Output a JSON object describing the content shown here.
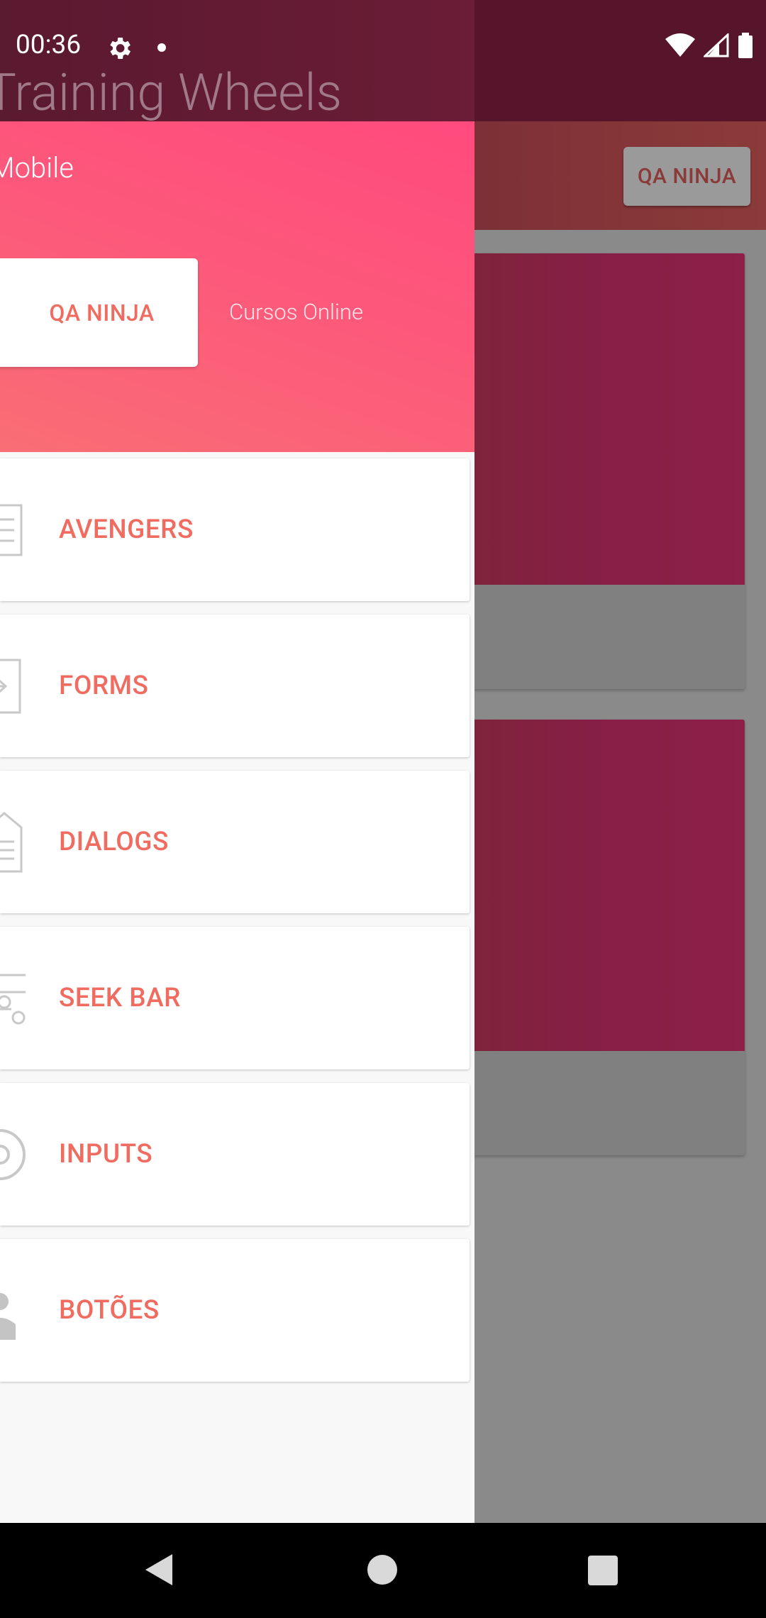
{
  "app": {
    "title": "Training Wheels",
    "subtitle": "Mobile"
  },
  "status_bar": {
    "time": "00:36",
    "icons": [
      "settings-icon",
      "notification-dot-icon",
      "wifi-icon",
      "signal-icon",
      "battery-icon"
    ]
  },
  "background": {
    "toolbar_button_label": "QA NINJA"
  },
  "drawer_header": {
    "button_label": "QA NINJA",
    "link_label": "Cursos Online"
  },
  "menu": {
    "items": [
      {
        "label": "AVENGERS",
        "icon": "list-icon"
      },
      {
        "label": "FORMS",
        "icon": "form-icon"
      },
      {
        "label": "DIALOGS",
        "icon": "document-icon"
      },
      {
        "label": "SEEK BAR",
        "icon": "sliders-icon"
      },
      {
        "label": "INPUTS",
        "icon": "eye-icon"
      },
      {
        "label": "BOTÕES",
        "icon": "user-icon"
      }
    ]
  },
  "colors": {
    "accent": "#f16c60",
    "header_gradient_start": "#ff4a7d",
    "header_gradient_end": "#f96e75",
    "status_bar": "#56152b"
  }
}
